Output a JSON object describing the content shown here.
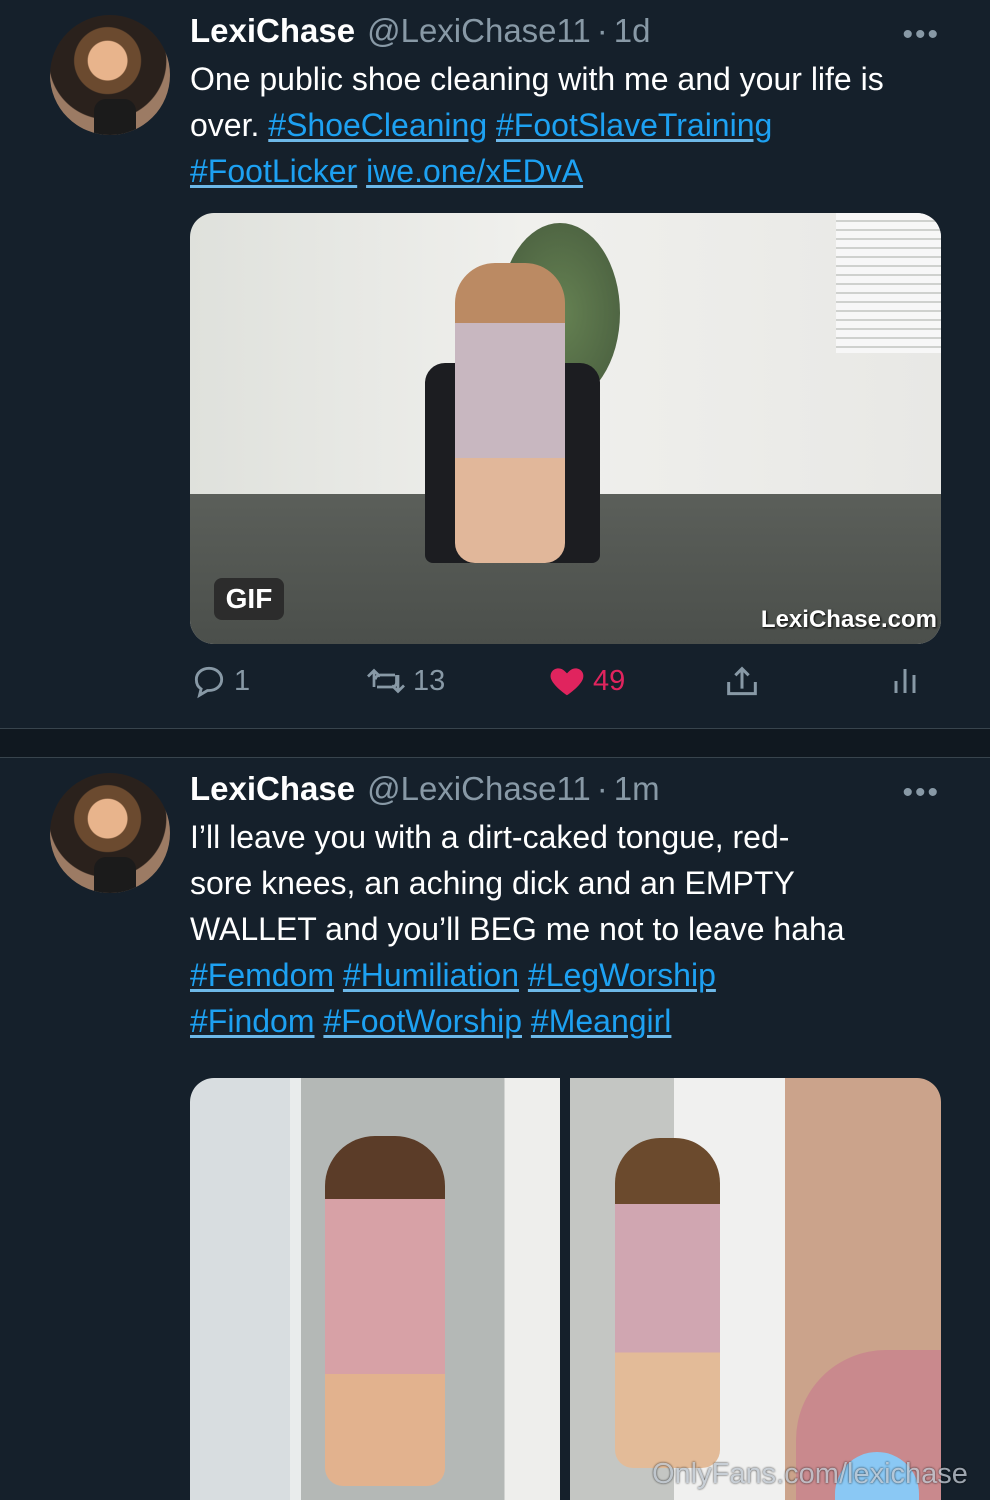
{
  "tweets": [
    {
      "name": "LexiChase",
      "handle": "@LexiChase11",
      "separator": "·",
      "time": "1d",
      "text_plain": "One public shoe cleaning with me and your life is over.",
      "hashtags": [
        "#ShoeCleaning",
        "#FootSlaveTraining",
        "#FootLicker"
      ],
      "link": "iwe.one/xEDvA",
      "media_badge": "GIF",
      "media_watermark": "LexiChase.com",
      "replies": "1",
      "retweets": "13",
      "likes": "49"
    },
    {
      "name": "LexiChase",
      "handle": "@LexiChase11",
      "separator": "·",
      "time": "1m",
      "text_plain_1": "I’ll leave you with a dirt-caked tongue, red-",
      "text_plain_2": "sore knees, an aching dick and an EMPTY",
      "text_plain_3": "WALLET and you’ll BEG me not to leave haha",
      "hashtags": [
        "#Femdom",
        "#Humiliation",
        "#LegWorship",
        "#Findom",
        "#FootWorship",
        "#Meangirl"
      ]
    }
  ],
  "overlay_watermark": "OnlyFans.com/lexichase",
  "colors": {
    "background": "#15202b",
    "accent": "#1da1f2",
    "like": "#e0245e",
    "muted": "#8899a6"
  },
  "icons": [
    "reply-icon",
    "retweet-icon",
    "heart-icon",
    "share-icon",
    "analytics-icon",
    "more-icon"
  ]
}
